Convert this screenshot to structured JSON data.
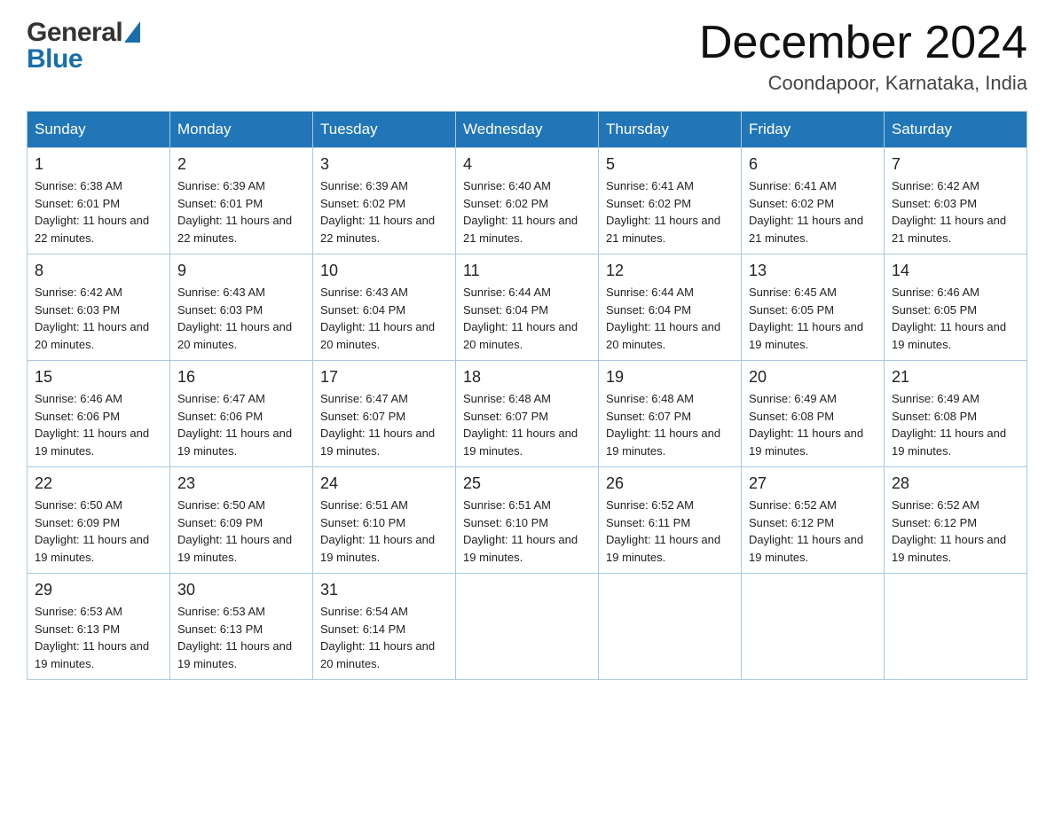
{
  "header": {
    "title": "December 2024",
    "location": "Coondapoor, Karnataka, India"
  },
  "logo": {
    "general": "General",
    "blue": "Blue"
  },
  "columns": [
    "Sunday",
    "Monday",
    "Tuesday",
    "Wednesday",
    "Thursday",
    "Friday",
    "Saturday"
  ],
  "weeks": [
    [
      {
        "day": "1",
        "sunrise": "6:38 AM",
        "sunset": "6:01 PM",
        "daylight": "11 hours and 22 minutes."
      },
      {
        "day": "2",
        "sunrise": "6:39 AM",
        "sunset": "6:01 PM",
        "daylight": "11 hours and 22 minutes."
      },
      {
        "day": "3",
        "sunrise": "6:39 AM",
        "sunset": "6:02 PM",
        "daylight": "11 hours and 22 minutes."
      },
      {
        "day": "4",
        "sunrise": "6:40 AM",
        "sunset": "6:02 PM",
        "daylight": "11 hours and 21 minutes."
      },
      {
        "day": "5",
        "sunrise": "6:41 AM",
        "sunset": "6:02 PM",
        "daylight": "11 hours and 21 minutes."
      },
      {
        "day": "6",
        "sunrise": "6:41 AM",
        "sunset": "6:02 PM",
        "daylight": "11 hours and 21 minutes."
      },
      {
        "day": "7",
        "sunrise": "6:42 AM",
        "sunset": "6:03 PM",
        "daylight": "11 hours and 21 minutes."
      }
    ],
    [
      {
        "day": "8",
        "sunrise": "6:42 AM",
        "sunset": "6:03 PM",
        "daylight": "11 hours and 20 minutes."
      },
      {
        "day": "9",
        "sunrise": "6:43 AM",
        "sunset": "6:03 PM",
        "daylight": "11 hours and 20 minutes."
      },
      {
        "day": "10",
        "sunrise": "6:43 AM",
        "sunset": "6:04 PM",
        "daylight": "11 hours and 20 minutes."
      },
      {
        "day": "11",
        "sunrise": "6:44 AM",
        "sunset": "6:04 PM",
        "daylight": "11 hours and 20 minutes."
      },
      {
        "day": "12",
        "sunrise": "6:44 AM",
        "sunset": "6:04 PM",
        "daylight": "11 hours and 20 minutes."
      },
      {
        "day": "13",
        "sunrise": "6:45 AM",
        "sunset": "6:05 PM",
        "daylight": "11 hours and 19 minutes."
      },
      {
        "day": "14",
        "sunrise": "6:46 AM",
        "sunset": "6:05 PM",
        "daylight": "11 hours and 19 minutes."
      }
    ],
    [
      {
        "day": "15",
        "sunrise": "6:46 AM",
        "sunset": "6:06 PM",
        "daylight": "11 hours and 19 minutes."
      },
      {
        "day": "16",
        "sunrise": "6:47 AM",
        "sunset": "6:06 PM",
        "daylight": "11 hours and 19 minutes."
      },
      {
        "day": "17",
        "sunrise": "6:47 AM",
        "sunset": "6:07 PM",
        "daylight": "11 hours and 19 minutes."
      },
      {
        "day": "18",
        "sunrise": "6:48 AM",
        "sunset": "6:07 PM",
        "daylight": "11 hours and 19 minutes."
      },
      {
        "day": "19",
        "sunrise": "6:48 AM",
        "sunset": "6:07 PM",
        "daylight": "11 hours and 19 minutes."
      },
      {
        "day": "20",
        "sunrise": "6:49 AM",
        "sunset": "6:08 PM",
        "daylight": "11 hours and 19 minutes."
      },
      {
        "day": "21",
        "sunrise": "6:49 AM",
        "sunset": "6:08 PM",
        "daylight": "11 hours and 19 minutes."
      }
    ],
    [
      {
        "day": "22",
        "sunrise": "6:50 AM",
        "sunset": "6:09 PM",
        "daylight": "11 hours and 19 minutes."
      },
      {
        "day": "23",
        "sunrise": "6:50 AM",
        "sunset": "6:09 PM",
        "daylight": "11 hours and 19 minutes."
      },
      {
        "day": "24",
        "sunrise": "6:51 AM",
        "sunset": "6:10 PM",
        "daylight": "11 hours and 19 minutes."
      },
      {
        "day": "25",
        "sunrise": "6:51 AM",
        "sunset": "6:10 PM",
        "daylight": "11 hours and 19 minutes."
      },
      {
        "day": "26",
        "sunrise": "6:52 AM",
        "sunset": "6:11 PM",
        "daylight": "11 hours and 19 minutes."
      },
      {
        "day": "27",
        "sunrise": "6:52 AM",
        "sunset": "6:12 PM",
        "daylight": "11 hours and 19 minutes."
      },
      {
        "day": "28",
        "sunrise": "6:52 AM",
        "sunset": "6:12 PM",
        "daylight": "11 hours and 19 minutes."
      }
    ],
    [
      {
        "day": "29",
        "sunrise": "6:53 AM",
        "sunset": "6:13 PM",
        "daylight": "11 hours and 19 minutes."
      },
      {
        "day": "30",
        "sunrise": "6:53 AM",
        "sunset": "6:13 PM",
        "daylight": "11 hours and 19 minutes."
      },
      {
        "day": "31",
        "sunrise": "6:54 AM",
        "sunset": "6:14 PM",
        "daylight": "11 hours and 20 minutes."
      },
      null,
      null,
      null,
      null
    ]
  ]
}
